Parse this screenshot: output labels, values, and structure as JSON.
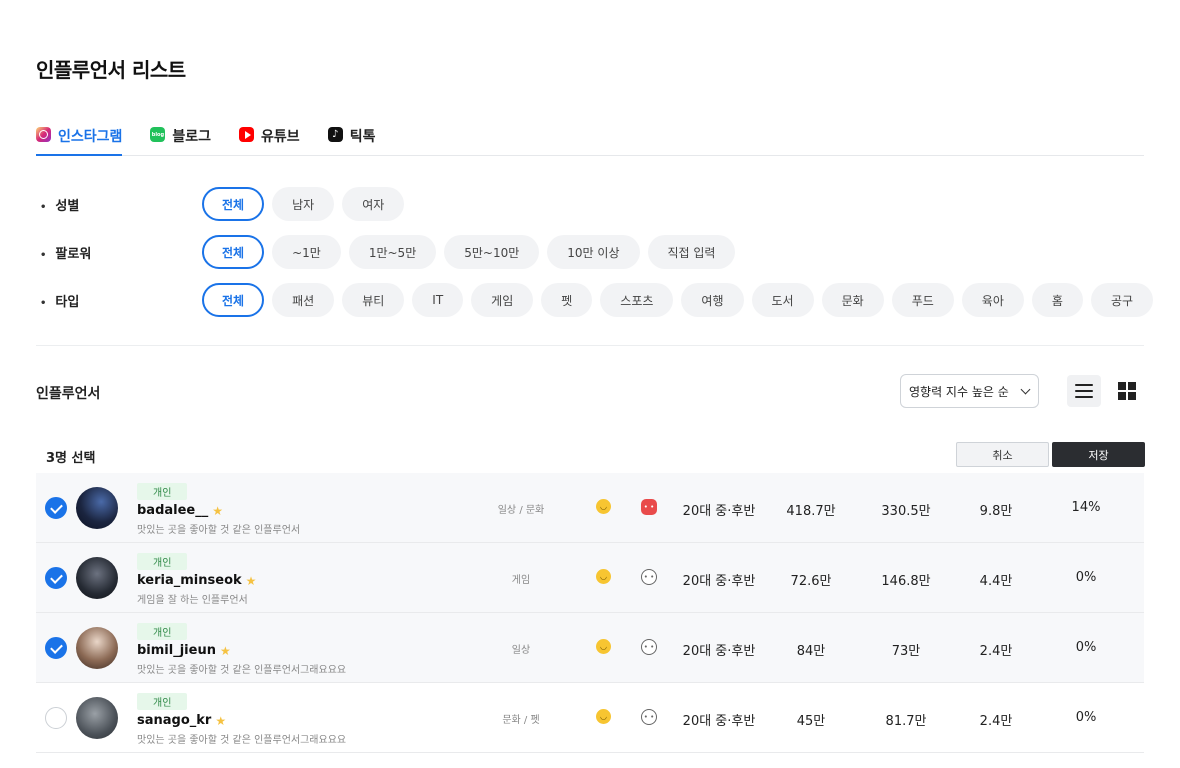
{
  "page_title": "인플루언서 리스트",
  "tabs": [
    {
      "label": "인스타그램",
      "icon": "instagram-icon",
      "active": true
    },
    {
      "label": "블로그",
      "icon": "blog-icon",
      "icon_text": "blog",
      "active": false
    },
    {
      "label": "유튜브",
      "icon": "youtube-icon",
      "active": false
    },
    {
      "label": "틱톡",
      "icon": "tiktok-icon",
      "icon_text": "♪",
      "active": false
    }
  ],
  "filters": {
    "gender": {
      "label": "성별",
      "options": [
        "전체",
        "남자",
        "여자"
      ],
      "selected": "전체"
    },
    "followers": {
      "label": "팔로워",
      "options": [
        "전체",
        "~1만",
        "1만~5만",
        "5만~10만",
        "10만 이상",
        "직접 입력"
      ],
      "selected": "전체"
    },
    "type": {
      "label": "타입",
      "options": [
        "전체",
        "패션",
        "뷰티",
        "IT",
        "게임",
        "펫",
        "스포츠",
        "여행",
        "도서",
        "문화",
        "푸드",
        "육아",
        "홈",
        "공구"
      ],
      "selected": "전체"
    }
  },
  "list": {
    "section_title": "인플루언서",
    "sort_value": "영향력 지수 높은 순",
    "selected_count": "3명 선택",
    "cancel_label": "취소",
    "save_label": "저장"
  },
  "rows": [
    {
      "checked": true,
      "badge": "개인",
      "username": "badalee__",
      "description": "맛있는 곳을 좋아할 것 같은 인플루언서",
      "category": "일상 / 문화",
      "face_style": "red",
      "age": "20대 중·후반",
      "followers": "418.7만",
      "views": "330.5만",
      "engagement": "9.8만",
      "rate": "14%"
    },
    {
      "checked": true,
      "badge": "개인",
      "username": "keria_minseok",
      "description": "게임을 잘 하는 인플루언서",
      "category": "게임",
      "face_style": "outline",
      "age": "20대 중·후반",
      "followers": "72.6만",
      "views": "146.8만",
      "engagement": "4.4만",
      "rate": "0%"
    },
    {
      "checked": true,
      "badge": "개인",
      "username": "bimil_jieun",
      "description": "맛있는 곳을 좋아할 것 같은 인플루언서그래요요요",
      "category": "일상",
      "face_style": "outline",
      "age": "20대 중·후반",
      "followers": "84만",
      "views": "73만",
      "engagement": "2.4만",
      "rate": "0%"
    },
    {
      "checked": false,
      "badge": "개인",
      "username": "sanago_kr",
      "description": "맛있는 곳을 좋아할 것 같은 인플루언서그래요요요",
      "category": "문화 / 펫",
      "face_style": "outline",
      "age": "20대 중·후반",
      "followers": "45만",
      "views": "81.7만",
      "engagement": "2.4만",
      "rate": "0%"
    }
  ],
  "colors": {
    "accent": "#1a73e8",
    "badge_bg": "#e6f7ea",
    "badge_text": "#2f8a47",
    "dark_button": "#2b2d31"
  }
}
